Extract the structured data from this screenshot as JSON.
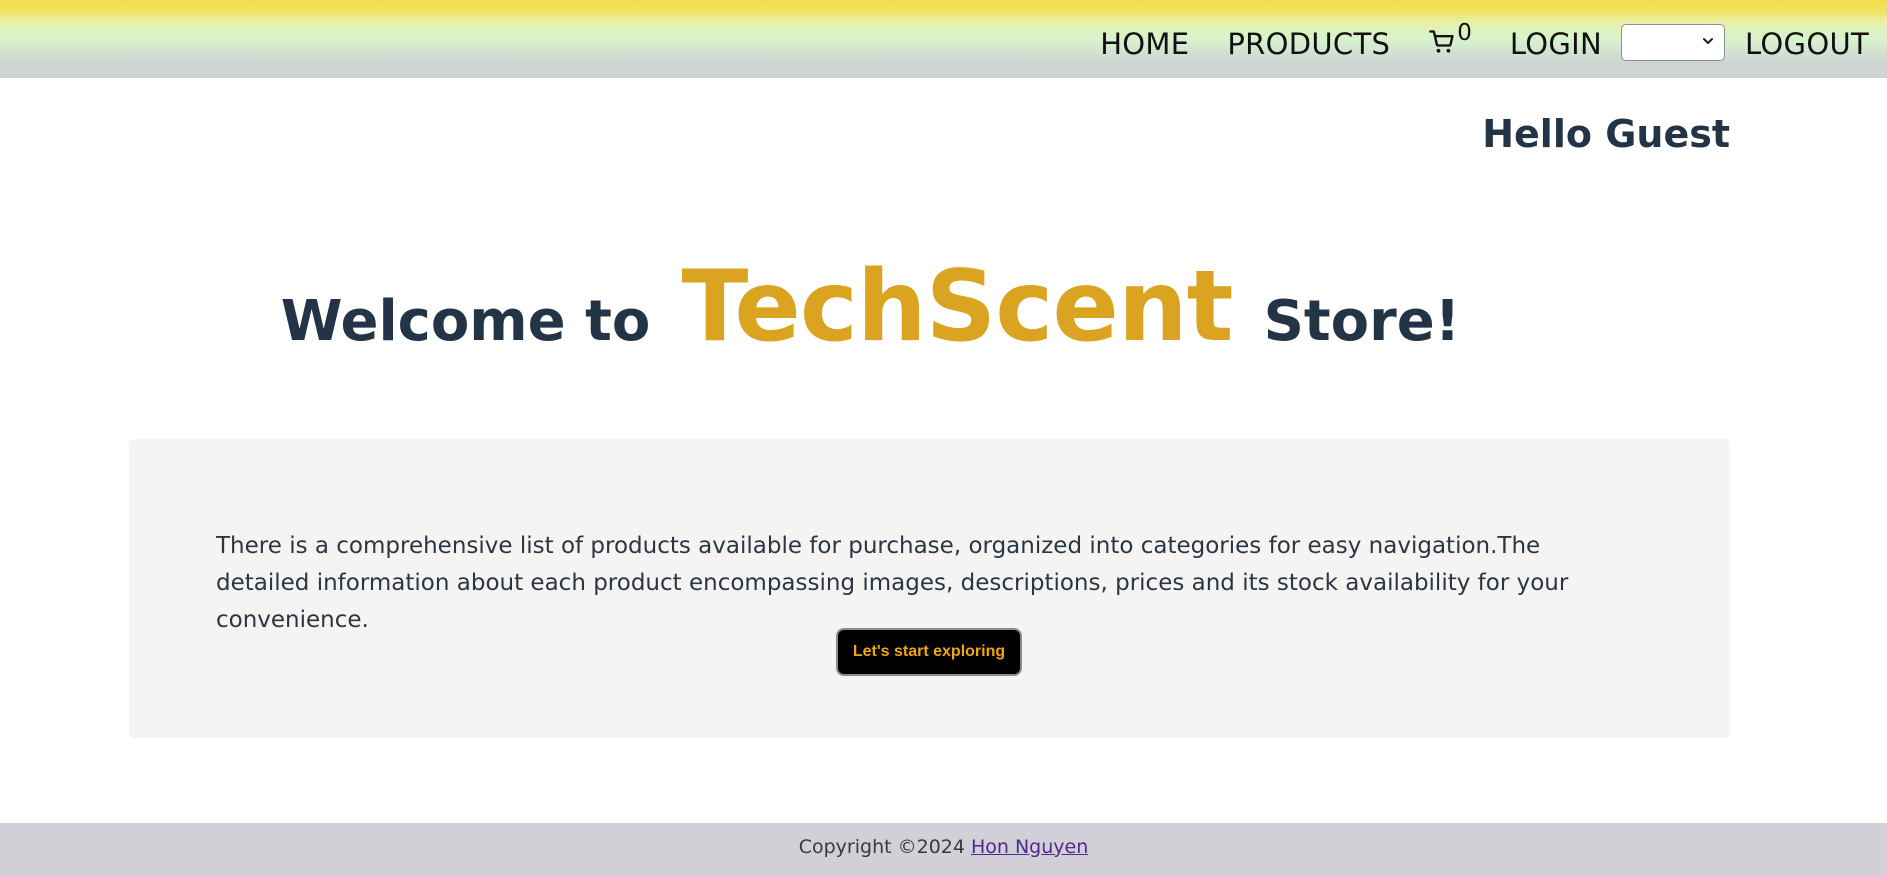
{
  "nav": {
    "home": "HOME",
    "products": "PRODUCTS",
    "cart_count": "0",
    "login": "LOGIN",
    "language_selected": "",
    "logout": "LOGOUT"
  },
  "greeting": "Hello Guest",
  "hero": {
    "prefix": "Welcome to",
    "brand": "TechScent",
    "suffix": "Store!"
  },
  "intro": {
    "text": "There is a comprehensive list of products available for purchase, organized into categories for easy navigation.The detailed information about each product encompassing images, descriptions, prices and its stock availability for your convenience.",
    "button_label": "Let's start exploring"
  },
  "footer": {
    "copyright": "Copyright ©2024",
    "author": "Hon Nguyen"
  },
  "colors": {
    "brand": "#daa320",
    "heading": "#243447",
    "button_text": "#f0a70a"
  }
}
